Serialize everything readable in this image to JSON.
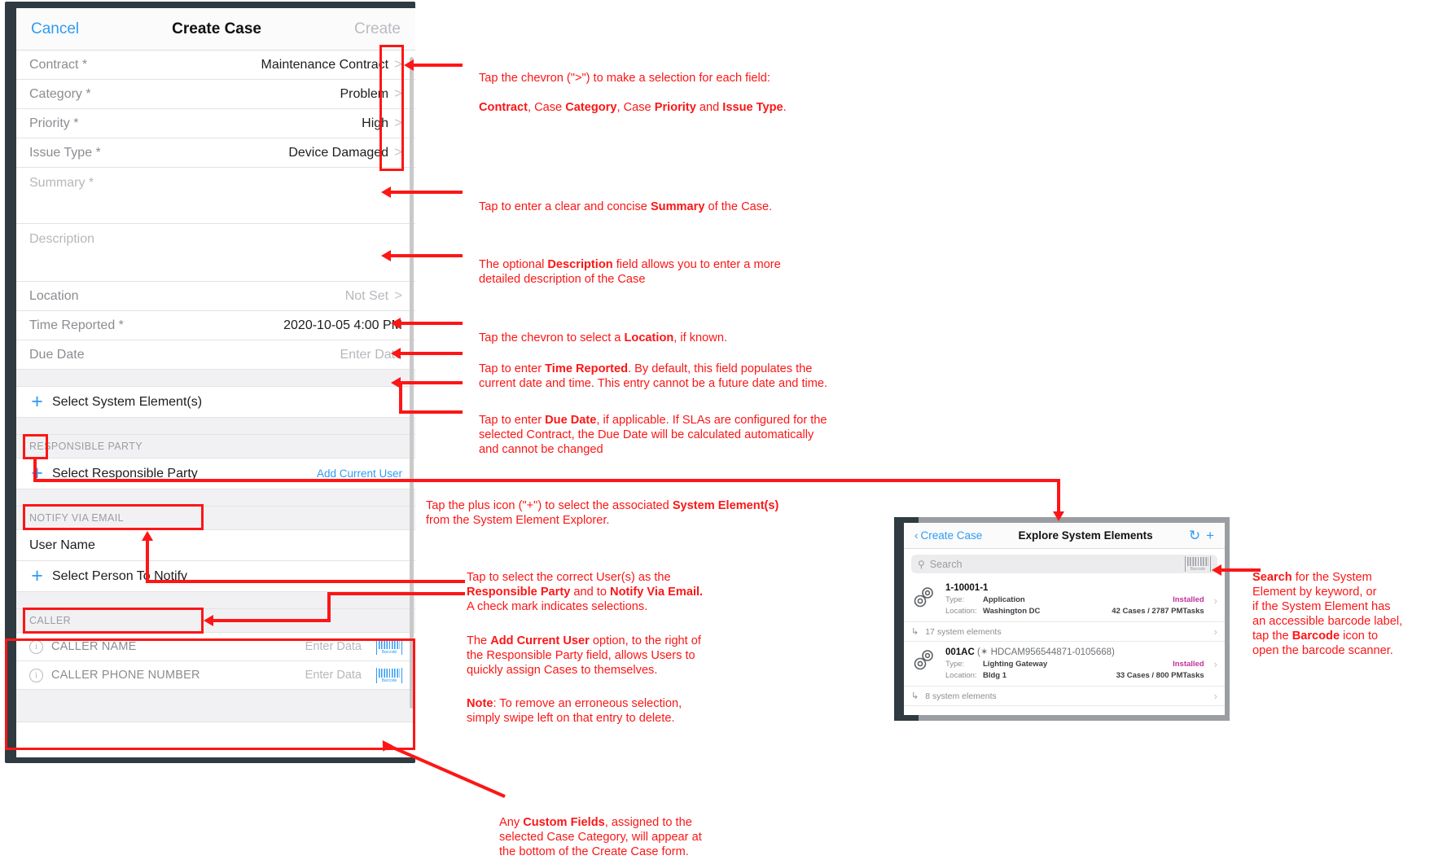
{
  "create_case": {
    "nav": {
      "cancel": "Cancel",
      "title": "Create Case",
      "create": "Create"
    },
    "fields": [
      {
        "label": "Contract *",
        "value": "Maintenance Contract",
        "chevron": ">"
      },
      {
        "label": "Category *",
        "value": "Problem",
        "chevron": ">"
      },
      {
        "label": "Priority *",
        "value": "High",
        "chevron": ">"
      },
      {
        "label": "Issue Type *",
        "value": "Device Damaged",
        "chevron": ">"
      }
    ],
    "summary_placeholder": "Summary *",
    "description_placeholder": "Description",
    "location": {
      "label": "Location",
      "value": "Not Set",
      "chevron": ">"
    },
    "time_reported": {
      "label": "Time Reported *",
      "value": "2020-10-05 4:00 PM"
    },
    "due_date": {
      "label": "Due Date",
      "value": "Enter Date"
    },
    "select_system_elements": "Select System Element(s)",
    "responsible_party_header": "RESPONSIBLE PARTY",
    "select_responsible_party": "Select Responsible Party",
    "add_current_user": "Add Current User",
    "notify_via_email_header": "NOTIFY VIA EMAIL",
    "user_name": "User Name",
    "select_person_to_notify": "Select Person To Notify",
    "caller_header": "CALLER",
    "caller_rows": [
      {
        "label": "CALLER NAME",
        "value": "Enter Data",
        "icon": "barcode-icon"
      },
      {
        "label": "CALLER PHONE NUMBER",
        "value": "Enter Data",
        "icon": "barcode-icon"
      }
    ]
  },
  "explorer": {
    "nav": {
      "back": "Create Case",
      "title": "Explore System Elements",
      "refresh": "refresh-icon",
      "add": "plus-icon"
    },
    "search_placeholder": "Search",
    "search_barcode": "Barcode",
    "items": [
      {
        "name": "1-10001-1",
        "suffix": "",
        "type_key": "Type:",
        "type_value": "Application",
        "status": "Installed",
        "location_key": "Location:",
        "location_value": "Washington DC",
        "counts": "42 Cases / 2787 PMTasks",
        "children": "17 system elements"
      },
      {
        "name": "001AC",
        "suffix": "(✶ HDCAM956544871-0105668)",
        "type_key": "Type:",
        "type_value": "Lighting Gateway",
        "status": "Installed",
        "location_key": "Location:",
        "location_value": "Bldg 1",
        "counts": "33 Cases / 800 PMTasks",
        "children": "8 system elements"
      }
    ]
  },
  "annotations": {
    "chevron_fields": {
      "line1": "Tap the chevron (\">\") to make a selection for each field:",
      "p1": "Contract",
      "p2": ", Case ",
      "p3": "Category",
      "p4": ", Case ",
      "p5": "Priority",
      "p6": " and ",
      "p7": "Issue Type",
      "p8": "."
    },
    "summary": {
      "a": "Tap to enter a clear and concise ",
      "b": "Summary",
      "c": " of the Case."
    },
    "description": {
      "a": "The optional ",
      "b": "Description",
      "c": " field allows you to enter a more\ndetailed description of the Case"
    },
    "location": {
      "a": "Tap the chevron to select a ",
      "b": "Location",
      "c": ", if known."
    },
    "time_reported": {
      "a": "Tap to enter ",
      "b": "Time Reported",
      "c": ". By default, this field populates the\ncurrent date and time. This entry cannot be a future date and time."
    },
    "due_date": {
      "a": "Tap to enter ",
      "b": "Due Date",
      "c": ", if applicable. If SLAs are configured for the\nselected Contract, the Due Date will be calculated automatically\nand cannot be changed"
    },
    "system_elements": {
      "a": "Tap the plus icon (\"+\") to select the associated ",
      "b": "System Element(s)",
      "c": "\nfrom the System Element Explorer."
    },
    "users": {
      "a": "Tap to select the correct User(s) as the\n",
      "b": "Responsible Party",
      "c": " and to ",
      "d": "Notify Via Email.",
      "e": "\nA check mark indicates selections."
    },
    "add_current_user": {
      "a": "The ",
      "b": "Add Current User",
      "c": " option, to the right of\nthe Responsible Party field, allows Users to\nquickly assign Cases to themselves."
    },
    "note": {
      "a": "Note",
      "b": ": To remove an erroneous selection,\nsimply swipe left on that entry to delete."
    },
    "search_barcode": {
      "a": "Search",
      "b": " for the System\nElement by keyword, or\nif the System Element has\nan accessible barcode label,\ntap the ",
      "c": "Barcode",
      "d": " icon to\nopen the barcode scanner."
    },
    "custom_fields": {
      "a": "Any ",
      "b": "Custom Fields",
      "c": ", assigned to the\nselected Case Category, will appear at\nthe bottom of the Create Case form."
    }
  },
  "colors": {
    "accent": "#2f9bf5",
    "annotation": "#fc1616",
    "status": "#c1329a"
  }
}
